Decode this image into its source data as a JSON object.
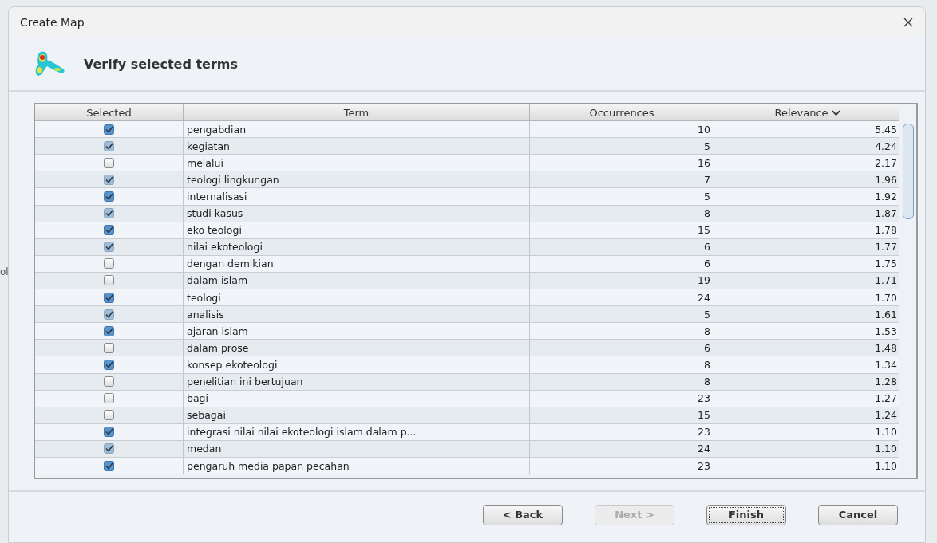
{
  "background_fragment": "ol",
  "window": {
    "title": "Create Map"
  },
  "header": {
    "title": "Verify selected terms"
  },
  "table": {
    "columns": [
      {
        "label": "Selected",
        "sorted": false
      },
      {
        "label": "Term",
        "sorted": false
      },
      {
        "label": "Occurrences",
        "sorted": false
      },
      {
        "label": "Relevance",
        "sorted": true
      }
    ],
    "rows": [
      {
        "selected": true,
        "term": "pengabdian",
        "occurrences": "10",
        "relevance": "5.45"
      },
      {
        "selected": true,
        "term": "kegiatan",
        "occurrences": "5",
        "relevance": "4.24"
      },
      {
        "selected": false,
        "term": "melalui",
        "occurrences": "16",
        "relevance": "2.17"
      },
      {
        "selected": true,
        "term": "teologi lingkungan",
        "occurrences": "7",
        "relevance": "1.96"
      },
      {
        "selected": true,
        "term": "internalisasi",
        "occurrences": "5",
        "relevance": "1.92"
      },
      {
        "selected": true,
        "term": "studi kasus",
        "occurrences": "8",
        "relevance": "1.87"
      },
      {
        "selected": true,
        "term": "eko teologi",
        "occurrences": "15",
        "relevance": "1.78"
      },
      {
        "selected": true,
        "term": "nilai ekoteologi",
        "occurrences": "6",
        "relevance": "1.77"
      },
      {
        "selected": false,
        "term": "dengan demikian",
        "occurrences": "6",
        "relevance": "1.75"
      },
      {
        "selected": false,
        "term": "dalam islam",
        "occurrences": "19",
        "relevance": "1.71"
      },
      {
        "selected": true,
        "term": "teologi",
        "occurrences": "24",
        "relevance": "1.70"
      },
      {
        "selected": true,
        "term": "analisis",
        "occurrences": "5",
        "relevance": "1.61"
      },
      {
        "selected": true,
        "term": "ajaran islam",
        "occurrences": "8",
        "relevance": "1.53"
      },
      {
        "selected": false,
        "term": "dalam prose",
        "occurrences": "6",
        "relevance": "1.48"
      },
      {
        "selected": true,
        "term": "konsep ekoteologi",
        "occurrences": "8",
        "relevance": "1.34"
      },
      {
        "selected": false,
        "term": "penelitian ini bertujuan",
        "occurrences": "8",
        "relevance": "1.28"
      },
      {
        "selected": false,
        "term": "bagi",
        "occurrences": "23",
        "relevance": "1.27"
      },
      {
        "selected": false,
        "term": "sebagai",
        "occurrences": "15",
        "relevance": "1.24"
      },
      {
        "selected": true,
        "term": "integrasi nilai nilai ekoteologi islam dalam p...",
        "occurrences": "23",
        "relevance": "1.10"
      },
      {
        "selected": true,
        "term": "medan",
        "occurrences": "24",
        "relevance": "1.10"
      },
      {
        "selected": true,
        "term": "pengaruh media papan pecahan",
        "occurrences": "23",
        "relevance": "1.10"
      }
    ]
  },
  "buttons": [
    {
      "label": "< Back",
      "disabled": false,
      "focused": false
    },
    {
      "label": "Next >",
      "disabled": true,
      "focused": false
    },
    {
      "label": "Finish",
      "disabled": false,
      "focused": true
    },
    {
      "label": "Cancel",
      "disabled": false,
      "focused": false
    }
  ]
}
